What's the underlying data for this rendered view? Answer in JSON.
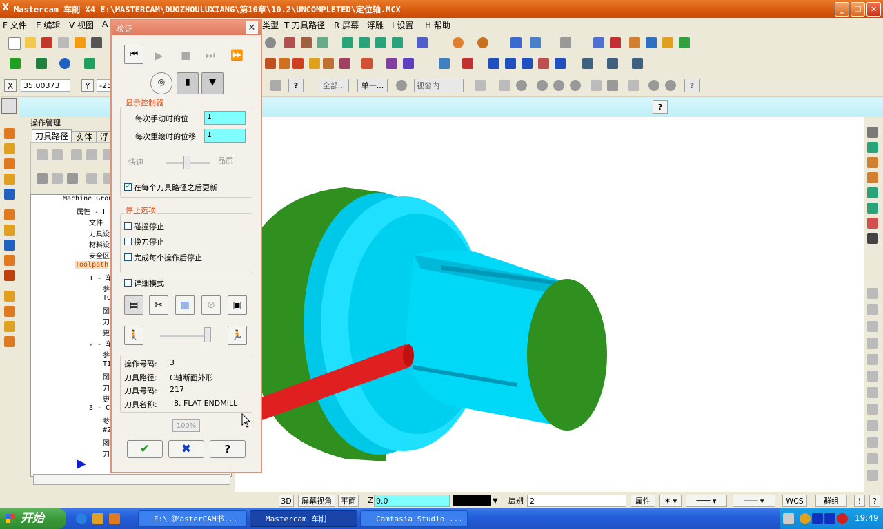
{
  "window": {
    "title": "Mastercam 车削   X4   E:\\MASTERCAM\\DUOZHOULUXIANG\\第10章\\10.2\\UNCOMPLETED\\定位轴.MCX",
    "app_icon": "X",
    "controls": [
      "_",
      "❐",
      "✕"
    ]
  },
  "menu": {
    "items": [
      "F 文件",
      "E 编辑",
      "V 视图",
      "A",
      "类型",
      "T 刀具路径",
      "R 屏幕",
      "浮雕",
      "I 设置",
      "H 帮助"
    ]
  },
  "coords": {
    "x_label": "X",
    "x_value": "35.00373",
    "y_label": "Y",
    "y_value": "-25"
  },
  "toolbar3": {
    "all_label": "全部...",
    "single_label": "单一...",
    "viewport_label": "视窗内"
  },
  "op_manager": {
    "title": "操作管理",
    "tabs": [
      "刀具路径",
      "实体",
      "浮"
    ],
    "tree": [
      "Machine Grou",
      "属性 - L",
      "文件",
      "刀具设",
      "材料设",
      "安全区",
      "Toolpath",
      "1 - 车",
      "参",
      "TO",
      "图",
      "刀",
      "更",
      "2 - 车",
      "参",
      "T1",
      "图",
      "刀",
      "更",
      "3 - C",
      "参",
      "#2",
      "图",
      "刀"
    ]
  },
  "dialog": {
    "title": "验证",
    "display_group": "显示控制器",
    "per_manual_label": "每次手动时的位",
    "per_manual_value": "1",
    "per_redraw_label": "每次重绘时的位移",
    "per_redraw_value": "1",
    "speed_fast": "快速",
    "speed_quality": "品质",
    "update_after_label": "在每个刀具路径之后更新",
    "update_after_checked": true,
    "stop_group": "停止选项",
    "stop_on_collision": "碰撞停止",
    "stop_on_tool_change": "换刀停止",
    "stop_after_op": "完成每个操作后停止",
    "verbose_mode": "详细模式",
    "info": [
      {
        "label": "操作号码:",
        "value": "3"
      },
      {
        "label": "刀具路径:",
        "value": "C轴断面外形"
      },
      {
        "label": "刀具号码:",
        "value": "217"
      },
      {
        "label": "刀具名称:",
        "value": "8. FLAT ENDMILL"
      }
    ],
    "progress": "100%",
    "ok_icon": "✔",
    "cancel_icon": "✖",
    "help_icon": "?"
  },
  "statusbar": {
    "view3d": "3D",
    "screen_view": "屏幕视角",
    "plane": "平面",
    "z_label": "Z",
    "z_value": "0.0",
    "level_label": "层别",
    "level_value": "2",
    "attr": "属性",
    "wcs": "WCS",
    "group": "群组"
  },
  "taskbar": {
    "start": "开始",
    "tasks": [
      "E:\\《MasterCAM书...",
      "Mastercam 车削",
      "Camtasia Studio ..."
    ],
    "time": "19:49"
  },
  "colors": {
    "title_orange": "#d9590e",
    "part_cyan": "#00e0ff",
    "part_green": "#2f8f1f",
    "tool_red": "#e02020"
  }
}
